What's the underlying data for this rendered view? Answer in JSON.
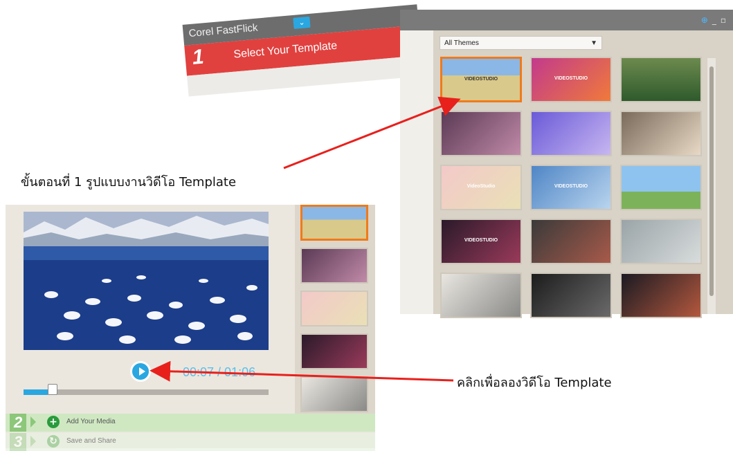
{
  "banner": {
    "app_name": "Corel FastFlick",
    "dropdown_glyph": "⌄",
    "step_number": "1",
    "step_label": "Select Your Template"
  },
  "template_browser": {
    "filter_select": {
      "selected": "All Themes"
    },
    "window_controls": [
      "globe-icon",
      "minimize-icon",
      "restore-icon"
    ],
    "thumbnails": [
      {
        "caption": "VIDEOSTUDIO",
        "selected": true
      },
      {
        "caption": "VIDEOSTUDIO",
        "selected": false
      },
      {
        "caption": "",
        "selected": false
      },
      {
        "caption": "",
        "selected": false
      },
      {
        "caption": "",
        "selected": false
      },
      {
        "caption": "",
        "selected": false
      },
      {
        "caption": "VideoStudio",
        "selected": false
      },
      {
        "caption": "VIDEOSTUDIO",
        "selected": false
      },
      {
        "caption": "",
        "selected": false
      },
      {
        "caption": "VIDEOSTUDIO",
        "selected": false
      },
      {
        "caption": "",
        "selected": false
      },
      {
        "caption": "",
        "selected": false
      },
      {
        "caption": "",
        "selected": false
      },
      {
        "caption": "",
        "selected": false
      },
      {
        "caption": "",
        "selected": false
      }
    ]
  },
  "player": {
    "timecode": "00:07 / 01:06",
    "progress_fraction": 0.1,
    "steps": [
      {
        "number": "2",
        "label": "Add Your Media",
        "icon": "plus-icon"
      },
      {
        "number": "3",
        "label": "Save and Share",
        "icon": "share-icon"
      }
    ]
  },
  "annotations": {
    "step1_caption": "ขั้นตอนที่ 1 รูปแบบงานวิดีโอ Template",
    "preview_caption": "คลิกเพื่อลองวิดีโอ Template"
  },
  "colors": {
    "accent_blue": "#2aa7e0",
    "step_red": "#e0413f",
    "selected_orange": "#f07a1a",
    "arrow_red": "#e8201c"
  }
}
